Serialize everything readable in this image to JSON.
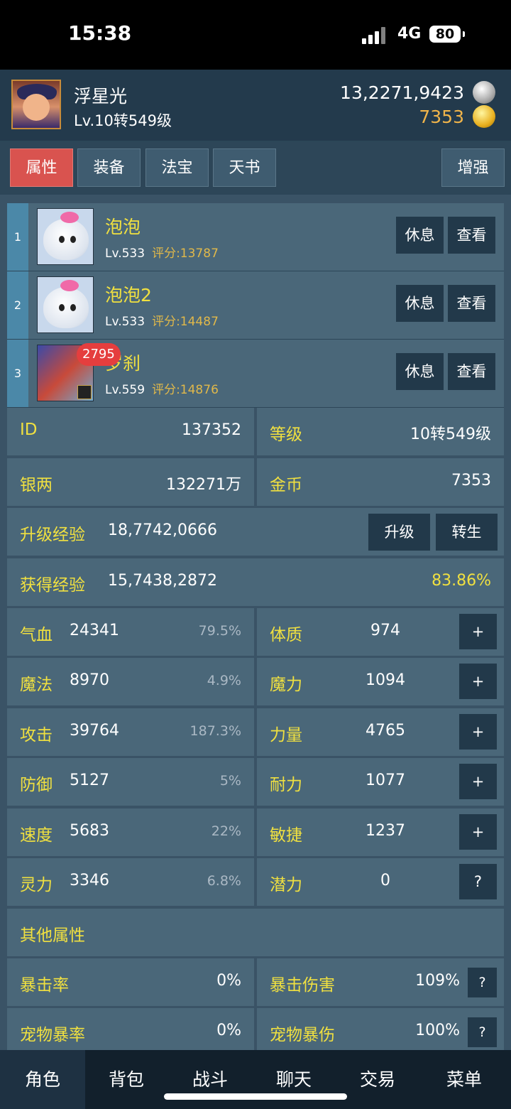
{
  "status_bar": {
    "time": "15:38",
    "network": "4G",
    "battery": "80"
  },
  "player": {
    "name": "浮星光",
    "level": "Lv.10转549级",
    "silver": "13,2271,9423",
    "gold": "7353",
    "silver_icon": "silver-coin-icon",
    "gold_icon": "gold-coin-icon"
  },
  "tabs": [
    {
      "label": "属性",
      "active": true
    },
    {
      "label": "装备"
    },
    {
      "label": "法宝"
    },
    {
      "label": "天书"
    }
  ],
  "enhance_label": "增强",
  "pets": [
    {
      "index": "1",
      "name": "泡泡",
      "level": "Lv.533",
      "score": "评分:13787",
      "rest": "休息",
      "view": "查看"
    },
    {
      "index": "2",
      "name": "泡泡2",
      "level": "Lv.533",
      "score": "评分:14487",
      "rest": "休息",
      "view": "查看"
    },
    {
      "index": "3",
      "name": "罗刹",
      "level": "Lv.559",
      "score": "评分:14876",
      "rest": "休息",
      "view": "查看",
      "badge": "2795"
    }
  ],
  "info": {
    "id_label": "ID",
    "id_value": "137352",
    "level_label": "等级",
    "level_value": "10转549级",
    "silver_label": "银两",
    "silver_value": "132271万",
    "gold_label": "金币",
    "gold_value": "7353",
    "upgrade_exp_label": "升级经验",
    "upgrade_exp_value": "18,7742,0666",
    "upgrade_btn": "升级",
    "rebirth_btn": "转生",
    "gained_exp_label": "获得经验",
    "gained_exp_value": "15,7438,2872",
    "exp_percent": "83.86%"
  },
  "stats": [
    {
      "label": "气血",
      "value": "24341",
      "pct": "79.5%",
      "attr_label": "体质",
      "attr_value": "974",
      "btn": "+"
    },
    {
      "label": "魔法",
      "value": "8970",
      "pct": "4.9%",
      "attr_label": "魔力",
      "attr_value": "1094",
      "btn": "+"
    },
    {
      "label": "攻击",
      "value": "39764",
      "pct": "187.3%",
      "attr_label": "力量",
      "attr_value": "4765",
      "btn": "+"
    },
    {
      "label": "防御",
      "value": "5127",
      "pct": "5%",
      "attr_label": "耐力",
      "attr_value": "1077",
      "btn": "+"
    },
    {
      "label": "速度",
      "value": "5683",
      "pct": "22%",
      "attr_label": "敏捷",
      "attr_value": "1237",
      "btn": "+"
    },
    {
      "label": "灵力",
      "value": "3346",
      "pct": "6.8%",
      "attr_label": "潜力",
      "attr_value": "0",
      "btn": "?"
    }
  ],
  "other_title": "其他属性",
  "other": [
    {
      "label": "暴击率",
      "value": "0%",
      "label2": "暴击伤害",
      "value2": "109%",
      "btn": "?"
    },
    {
      "label": "宠物暴率",
      "value": "0%",
      "label2": "宠物暴伤",
      "value2": "100%",
      "btn": "?"
    }
  ],
  "nav": [
    {
      "label": "角色",
      "active": true
    },
    {
      "label": "背包"
    },
    {
      "label": "战斗"
    },
    {
      "label": "聊天"
    },
    {
      "label": "交易"
    },
    {
      "label": "菜单"
    }
  ]
}
